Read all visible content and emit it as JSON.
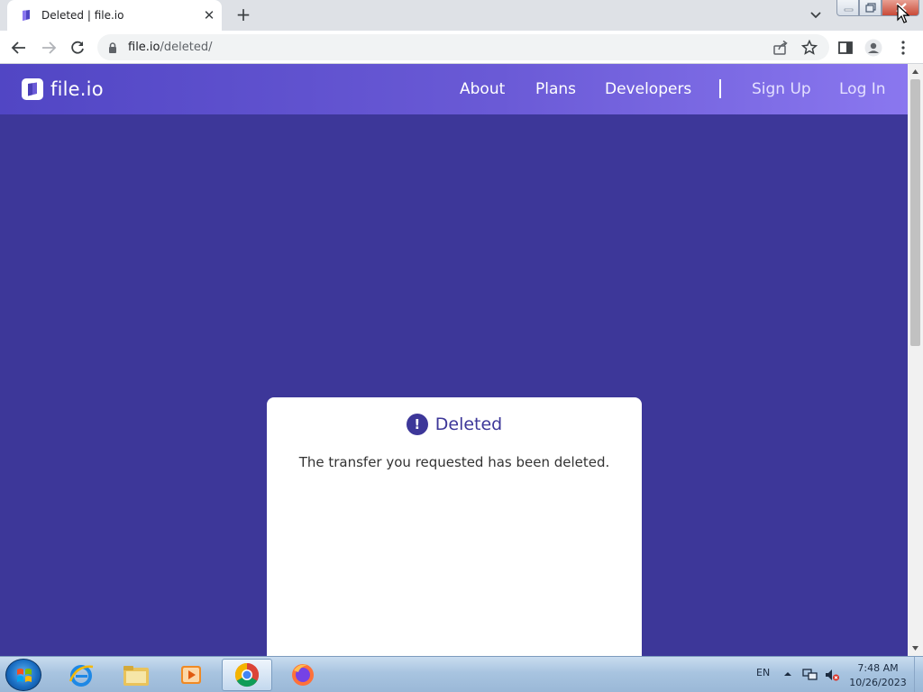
{
  "browser": {
    "tab": {
      "title": "Deleted | file.io",
      "close_label": "✕"
    },
    "new_tab_label": "+",
    "address": {
      "host": "file.io",
      "path": "/deleted/"
    }
  },
  "site": {
    "logo_text": "file.io",
    "nav": {
      "about": "About",
      "plans": "Plans",
      "developers": "Developers",
      "sign_up": "Sign Up",
      "log_in": "Log In"
    },
    "notice": {
      "icon_text": "!",
      "title": "Deleted",
      "message": "The transfer you requested has been deleted."
    }
  },
  "taskbar": {
    "language": "EN",
    "time": "7:48 AM",
    "date": "10/26/2023"
  },
  "colors": {
    "page_background": "#3d3799",
    "nav_gradient_start": "#5146c4",
    "nav_gradient_end": "#8a77ef",
    "card_background": "#ffffff",
    "accent": "#3d3799"
  }
}
